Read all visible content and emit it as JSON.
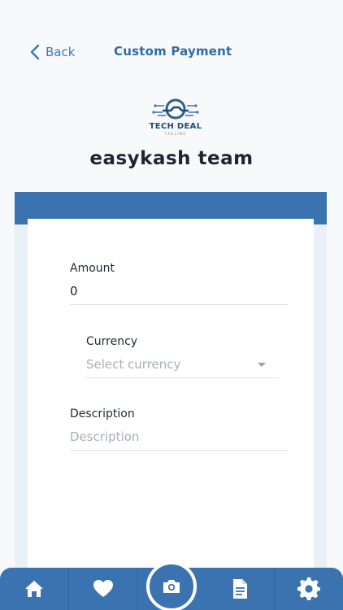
{
  "header": {
    "back_label": "Back",
    "title": "Custom Payment"
  },
  "logo": {
    "name": "TECH DEAL",
    "tagline": "TAGLINE"
  },
  "merchant": {
    "name": "easykash team"
  },
  "form": {
    "amount": {
      "label": "Amount",
      "value": "0"
    },
    "currency": {
      "label": "Currency",
      "placeholder": "Select currency"
    },
    "description": {
      "label": "Description",
      "placeholder": "Description"
    }
  },
  "tabbar": {
    "items": [
      {
        "icon": "home-icon"
      },
      {
        "icon": "heart-icon"
      },
      {
        "icon": "camera-icon"
      },
      {
        "icon": "document-icon"
      },
      {
        "icon": "gear-icon"
      }
    ]
  },
  "colors": {
    "accent": "#3a73b0",
    "title": "#2f6ea8",
    "panel_bg": "#e9f0f8"
  }
}
